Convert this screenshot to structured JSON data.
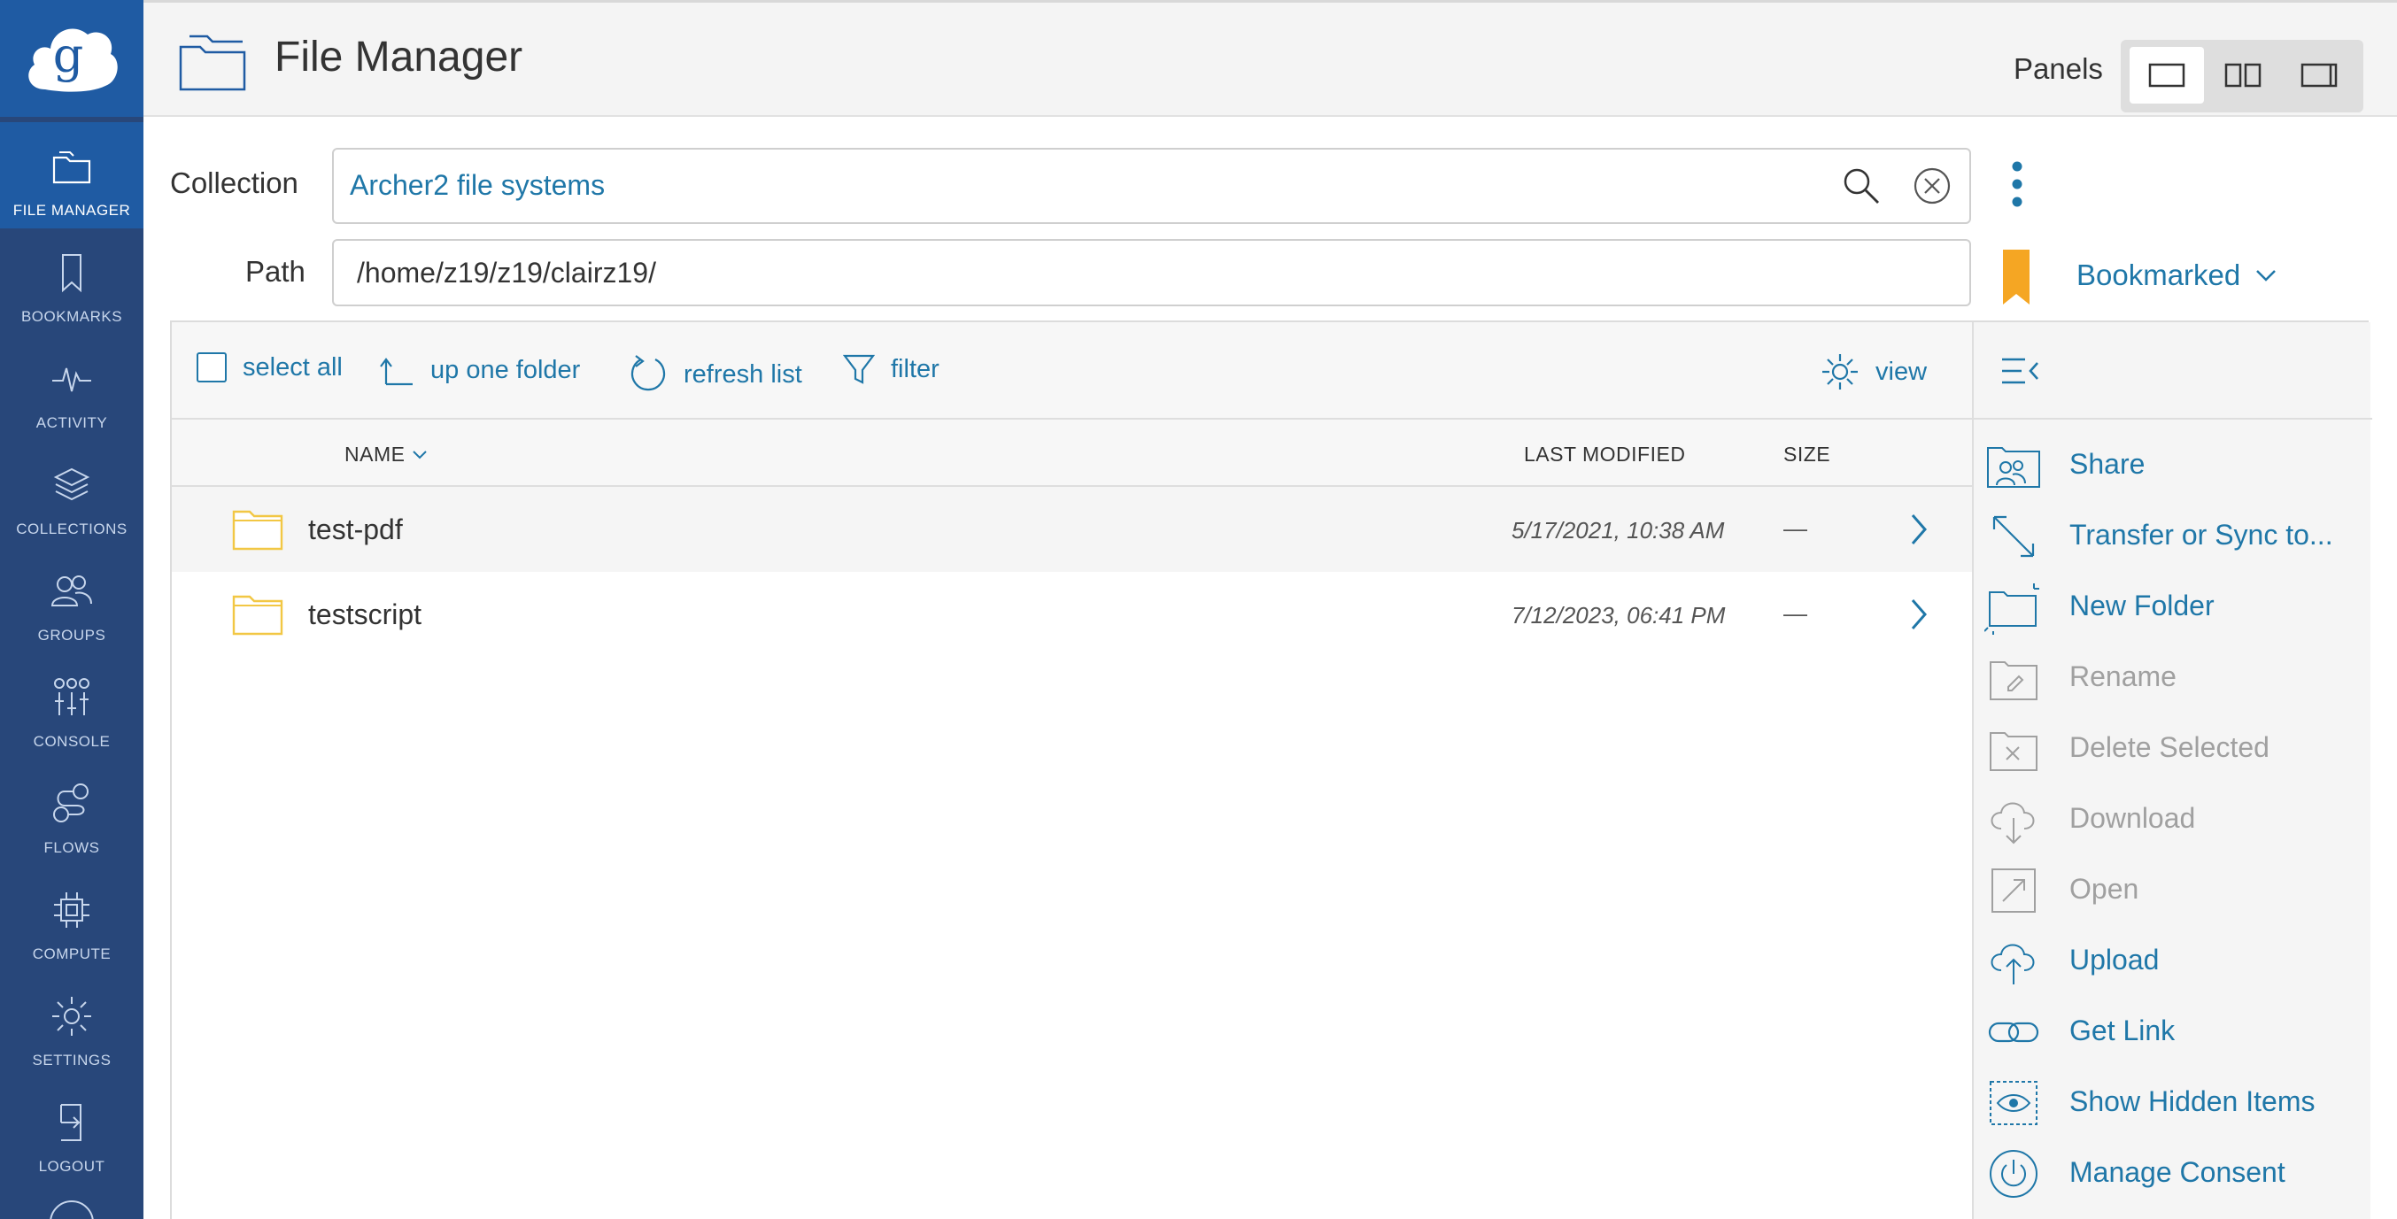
{
  "nav": {
    "items": [
      {
        "label": "FILE MANAGER",
        "icon": "file-manager-icon",
        "active": true
      },
      {
        "label": "BOOKMARKS",
        "icon": "bookmark-icon"
      },
      {
        "label": "ACTIVITY",
        "icon": "activity-icon"
      },
      {
        "label": "COLLECTIONS",
        "icon": "collections-icon"
      },
      {
        "label": "GROUPS",
        "icon": "groups-icon"
      },
      {
        "label": "CONSOLE",
        "icon": "console-icon"
      },
      {
        "label": "FLOWS",
        "icon": "flows-icon"
      },
      {
        "label": "COMPUTE",
        "icon": "compute-icon"
      },
      {
        "label": "SETTINGS",
        "icon": "gear-icon"
      },
      {
        "label": "LOGOUT",
        "icon": "logout-icon"
      }
    ]
  },
  "header": {
    "title": "File Manager",
    "panels_label": "Panels"
  },
  "collection": {
    "label": "Collection",
    "value": "Archer2 file systems"
  },
  "path": {
    "label": "Path",
    "value": "/home/z19/z19/clairz19/"
  },
  "bookmark": {
    "label": "Bookmarked"
  },
  "toolbar": {
    "select_all": "select all",
    "up_one_folder": "up one folder",
    "refresh_list": "refresh list",
    "filter": "filter",
    "view": "view"
  },
  "columns": {
    "name": "NAME",
    "last_modified": "LAST MODIFIED",
    "size": "SIZE"
  },
  "files": [
    {
      "name": "test-pdf",
      "modified": "5/17/2021, 10:38 AM",
      "size": "—"
    },
    {
      "name": "testscript",
      "modified": "7/12/2023, 06:41 PM",
      "size": "—"
    }
  ],
  "actions": [
    {
      "label": "Share",
      "icon": "share-icon",
      "enabled": true
    },
    {
      "label": "Transfer or Sync to...",
      "icon": "transfer-icon",
      "enabled": true
    },
    {
      "label": "New Folder",
      "icon": "new-folder-icon",
      "enabled": true
    },
    {
      "label": "Rename",
      "icon": "rename-icon",
      "enabled": false
    },
    {
      "label": "Delete Selected",
      "icon": "delete-icon",
      "enabled": false
    },
    {
      "label": "Download",
      "icon": "download-icon",
      "enabled": false
    },
    {
      "label": "Open",
      "icon": "open-icon",
      "enabled": false
    },
    {
      "label": "Upload",
      "icon": "upload-icon",
      "enabled": true
    },
    {
      "label": "Get Link",
      "icon": "link-icon",
      "enabled": true
    },
    {
      "label": "Show Hidden Items",
      "icon": "eye-icon",
      "enabled": true
    },
    {
      "label": "Manage Consent",
      "icon": "power-icon",
      "enabled": true
    }
  ],
  "colors": {
    "nav_bg": "#28477a",
    "nav_active": "#1f5ba3",
    "link": "#1f77a8",
    "bookmark": "#f5a623",
    "folder": "#f2c744",
    "disabled": "#a0a0a0"
  }
}
